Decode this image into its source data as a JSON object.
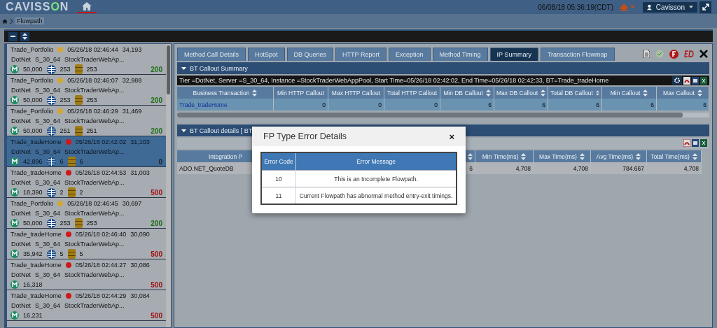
{
  "header": {
    "logo": "CAVISSON",
    "datetime": "06/08/18 05:36:19(CDT)",
    "user": "Cavisson"
  },
  "breadcrumb": {
    "current": "Flowpath"
  },
  "flowpaths": [
    {
      "name": "Trade_Portfolio",
      "status": {
        "color": "#d4a730"
      },
      "time": "05/26/18 02:46:44",
      "id": "34,193",
      "tier": "DotNet",
      "server": "S_30_64",
      "instance": "StockTraderWebAp...",
      "methods": "50,000",
      "http": "253",
      "db": "253",
      "response": {
        "text": "200",
        "color": "#1e6e14"
      },
      "selected": false
    },
    {
      "name": "Trade_Portfolio",
      "status": {
        "color": "#d4a730"
      },
      "time": "05/26/18 02:46:07",
      "id": "32,988",
      "tier": "DotNet",
      "server": "S_30_64",
      "instance": "StockTraderWebAp...",
      "methods": "50,000",
      "http": "253",
      "db": "253",
      "response": {
        "text": "200",
        "color": "#1e6e14"
      },
      "selected": false
    },
    {
      "name": "Trade_Portfolio",
      "status": {
        "color": "#d4a730"
      },
      "time": "05/26/18 02:46:29",
      "id": "31,469",
      "tier": "DotNet",
      "server": "S_30_64",
      "instance": "StockTraderWebAp...",
      "methods": "50,000",
      "http": "251",
      "db": "251",
      "response": {
        "text": "200",
        "color": "#1e6e14"
      },
      "selected": false
    },
    {
      "name": "Trade_tradeHome",
      "status": {
        "color": "#d01818"
      },
      "time": "05/26/18 02:42:02",
      "id": "31,103",
      "tier": "DotNet",
      "server": "S_30_64",
      "instance": "StockTraderWebAp...",
      "methods": "42,896",
      "http": "6",
      "db": "6",
      "response": {
        "text": "0",
        "color": "#222222"
      },
      "selected": true
    },
    {
      "name": "Trade_tradeHome",
      "status": {
        "color": "#d01818"
      },
      "time": "05/26/18 02:44:53",
      "id": "31,003",
      "tier": "DotNet",
      "server": "S_30_64",
      "instance": "StockTraderWebAp...",
      "methods": "18,390",
      "http": "2",
      "db": "2",
      "response": {
        "text": "500",
        "color": "#a01010"
      },
      "selected": false
    },
    {
      "name": "Trade_Portfolio",
      "status": {
        "color": "#d4a730"
      },
      "time": "05/26/18 02:46:45",
      "id": "30,697",
      "tier": "DotNet",
      "server": "S_30_64",
      "instance": "StockTraderWebAp...",
      "methods": "50,000",
      "http": "253",
      "db": "253",
      "response": {
        "text": "200",
        "color": "#1e6e14"
      },
      "selected": false
    },
    {
      "name": "Trade_tradeHome",
      "status": {
        "color": "#d01818"
      },
      "time": "05/26/18 02:46:40",
      "id": "30,090",
      "tier": "DotNet",
      "server": "S_30_64",
      "instance": "StockTraderWebAp...",
      "methods": "35,942",
      "http": "5",
      "db": "5",
      "response": {
        "text": "500",
        "color": "#a01010"
      },
      "selected": false
    },
    {
      "name": "Trade_tradeHome",
      "status": {
        "color": "#d01818"
      },
      "time": "05/26/18 02:44:27",
      "id": "30,086",
      "tier": "DotNet",
      "server": "S_30_64",
      "instance": "StockTraderWebAp...",
      "methods": "16,318",
      "response": {
        "text": "500",
        "color": "#a01010"
      },
      "selected": false
    },
    {
      "name": "Trade_tradeHome",
      "status": {
        "color": "#d01818"
      },
      "time": "05/26/18 02:44:29",
      "id": "30,084",
      "tier": "DotNet",
      "server": "S_30_64",
      "instance": "StockTraderWebAp...",
      "methods": "16,231",
      "response": {
        "text": "500",
        "color": "#a01010"
      },
      "selected": false
    }
  ],
  "tabs": [
    {
      "label": "Method Call Details",
      "selected": false
    },
    {
      "label": "HotSpot",
      "selected": false
    },
    {
      "label": "DB Queries",
      "selected": false
    },
    {
      "label": "HTTP Report",
      "selected": false
    },
    {
      "label": "Exception",
      "selected": false
    },
    {
      "label": "Method Timing",
      "selected": false
    },
    {
      "label": "IP Summary",
      "selected": true
    },
    {
      "label": "Transaction Flowmap",
      "selected": false
    }
  ],
  "summary": {
    "title": "BT Callout Summary",
    "info": "Tier =DotNet, Server =S_30_64, Instance =StockTraderWebAppPool, Start Time=05/26/18 02:42:02, End Time=05/26/18 02:42:33, BT=Trade_tradeHome",
    "columns": [
      "Business Transaction",
      "Min HTTP Callout",
      "Max HTTP Callout",
      "Total HTTP Callout",
      "Min DB Callout",
      "Max DB Callout",
      "Total DB Callout",
      "Min Callout",
      "Max Callout"
    ],
    "rows": [
      [
        "Trade_tradeHome",
        "0",
        "0",
        "0",
        "6",
        "6",
        "6",
        "6",
        "6"
      ]
    ]
  },
  "details": {
    "title": "BT Callout details [ BT",
    "columns": [
      "Integration P",
      "",
      "Min Time(ms)",
      "Max Time(ms)",
      "Avg Time(ms)",
      "Total Time(ms)"
    ],
    "rows": [
      [
        "ADO.NET_QuoteDB",
        "6",
        "4,708",
        "4,708",
        "784.667",
        "4,708"
      ]
    ]
  },
  "dialog": {
    "title": "FP Type Error Details",
    "close": "×",
    "columns": [
      "Error Code",
      "Error Message"
    ],
    "rows": [
      [
        "10",
        "This is an Incomplete Flowpath."
      ],
      [
        "11",
        "Current Flowpath has abnormal method entry-exit timings."
      ]
    ]
  }
}
